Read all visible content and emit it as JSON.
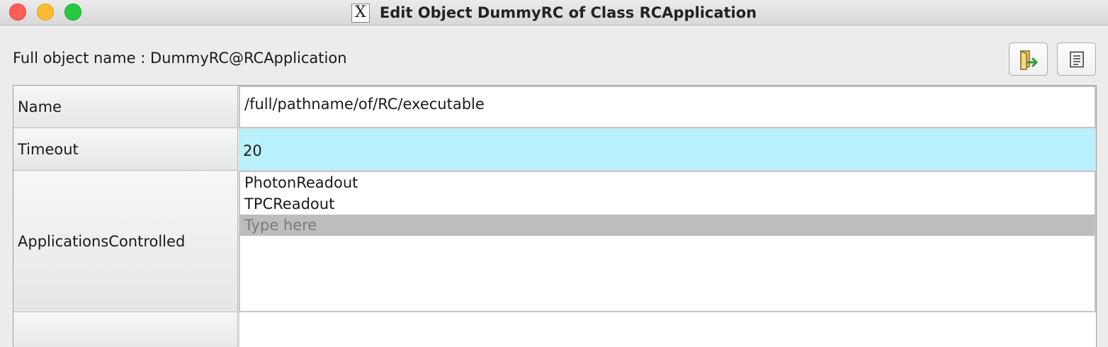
{
  "window": {
    "title": "Edit Object DummyRC of Class RCApplication",
    "app_icon": "x11-icon",
    "app_icon_glyph": "X"
  },
  "header": {
    "full_object_label": "Full object name : DummyRC@RCApplication",
    "buttons": [
      {
        "icon": "open-folder-arrow-icon"
      },
      {
        "icon": "document-details-icon"
      }
    ]
  },
  "attributes": {
    "name": {
      "label": "Name",
      "value": "/full/pathname/of/RC/executable"
    },
    "timeout": {
      "label": "Timeout",
      "value": "20"
    },
    "applications_controlled": {
      "label": "ApplicationsControlled",
      "items": [
        "PhotonReadout",
        "TPCReadout"
      ],
      "placeholder": "Type here"
    }
  },
  "colors": {
    "active_cell": "#b8f1fb",
    "placeholder_row": "#bdbdbd",
    "close_button": "#fe5f57",
    "minimize_button": "#febc2e",
    "maximize_button": "#28c840"
  }
}
